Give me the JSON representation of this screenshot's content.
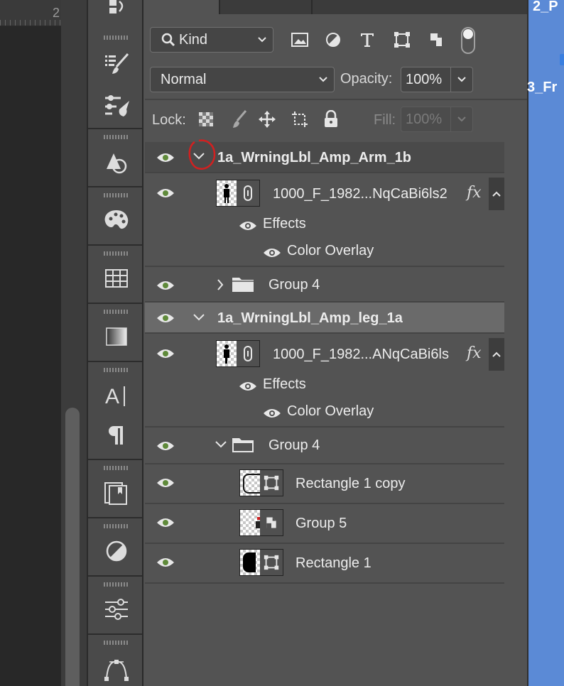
{
  "ruler": {
    "number": "2"
  },
  "tools": [
    {
      "name": "history-brush-icon"
    },
    {
      "name": "brush-list-icon"
    },
    {
      "name": "brush-settings-icon"
    },
    {
      "name": "shapes-icon"
    },
    {
      "name": "color-palette-icon"
    },
    {
      "name": "swatches-grid-icon"
    },
    {
      "name": "gradients-icon"
    },
    {
      "name": "character-icon"
    },
    {
      "name": "paragraph-icon"
    },
    {
      "name": "properties-icon"
    },
    {
      "name": "adjustments-icon"
    },
    {
      "name": "sliders-icon"
    },
    {
      "name": "paths-icon"
    }
  ],
  "filter": {
    "kind_label": "Kind"
  },
  "blend": {
    "mode": "Normal",
    "opacity_label": "Opacity:",
    "opacity_value": "100%"
  },
  "lock": {
    "label": "Lock:",
    "fill_label": "Fill:",
    "fill_value": "100%"
  },
  "layers": {
    "group1": {
      "name": "1a_WrningLbl_Amp_Arm_1b"
    },
    "smart1": {
      "name": "1000_F_1982...NqCaBi6ls2",
      "fx": "fx"
    },
    "effects1": {
      "label": "Effects"
    },
    "overlay1": {
      "label": "Color Overlay"
    },
    "group4a": {
      "name": "Group 4"
    },
    "group2": {
      "name": "1a_WrningLbl_Amp_leg_1a"
    },
    "smart2": {
      "name": "1000_F_1982...ANqCaBi6ls",
      "fx": "fx"
    },
    "effects2": {
      "label": "Effects"
    },
    "overlay2": {
      "label": "Color Overlay"
    },
    "group4b": {
      "name": "Group 4"
    },
    "rect1copy": {
      "name": "Rectangle 1 copy"
    },
    "group5": {
      "name": "Group 5"
    },
    "rect1": {
      "name": "Rectangle 1"
    }
  },
  "desktop": {
    "item1": "2_P",
    "item2": "3_Fr"
  },
  "colors": {
    "visibility_column": "#5f8a3a",
    "annotation": "#d22020",
    "desktop": "#5b8ad6"
  }
}
